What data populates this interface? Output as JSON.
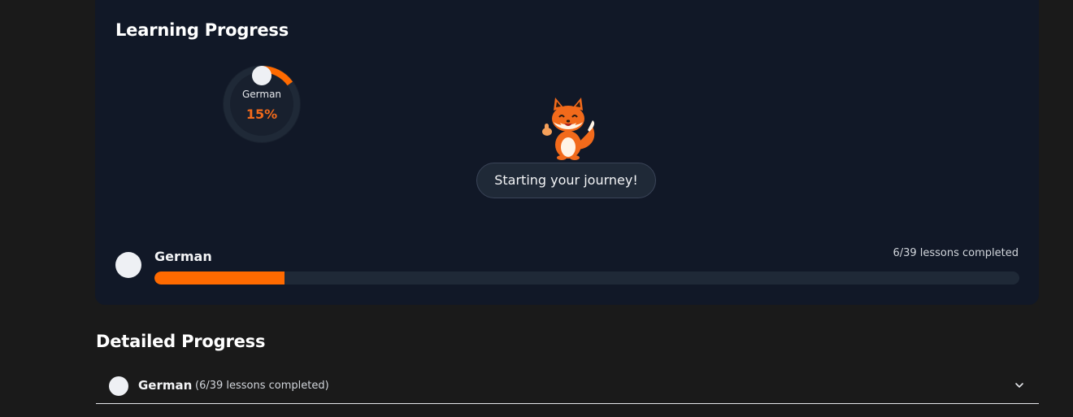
{
  "learning_progress": {
    "title": "Learning Progress",
    "ring": {
      "language": "German",
      "percent_label": "15%",
      "percent": 15,
      "flag_icon": "german-flag-icon"
    },
    "mascot": {
      "icon": "fox-mascot-thumbs-up",
      "message": "Starting your journey!"
    },
    "course": {
      "language": "German",
      "lessons_label": "6/39 lessons completed",
      "completed": 6,
      "total": 39,
      "progress_fraction": 0.15
    }
  },
  "detailed_progress": {
    "title": "Detailed Progress",
    "items": [
      {
        "language": "German",
        "lessons_label": "(6/39 lessons completed)",
        "expand_icon": "chevron-down-icon"
      }
    ]
  },
  "colors": {
    "accent": "#ff6a00",
    "card_bg": "#111827",
    "page_bg": "#1a1a1a",
    "track": "#1f2937"
  }
}
